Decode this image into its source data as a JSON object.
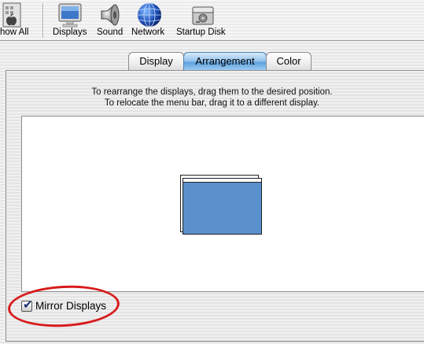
{
  "toolbar": {
    "show_all": "how All",
    "displays": "Displays",
    "sound": "Sound",
    "network": "Network",
    "startup_disk": "Startup Disk"
  },
  "tabs": [
    {
      "label": "Display",
      "active": false
    },
    {
      "label": "Arrangement",
      "active": true
    },
    {
      "label": "Color",
      "active": false
    }
  ],
  "instructions": {
    "line1": "To rearrange the displays, drag them to the desired position.",
    "line2": "To relocate the menu bar, drag it to a different display."
  },
  "mirror": {
    "label": "Mirror Displays",
    "checked": true,
    "check_glyph": "✔"
  },
  "colors": {
    "display_fill": "#5a90cc",
    "tab_active": "#6aa8e2",
    "annotation": "#d81c1c"
  },
  "icons": [
    "apple-icon",
    "displays-icon",
    "sound-icon",
    "network-globe-icon",
    "startup-disk-icon"
  ]
}
